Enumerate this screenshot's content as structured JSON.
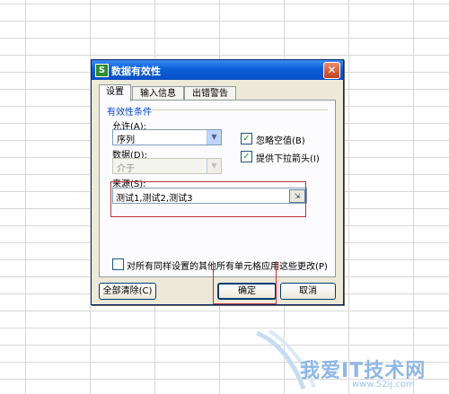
{
  "dialog": {
    "title": "数据有效性",
    "icon_letter": "S",
    "close_glyph": "✕",
    "tabs": [
      {
        "label": "设置",
        "active": true
      },
      {
        "label": "输入信息",
        "active": false
      },
      {
        "label": "出错警告",
        "active": false
      }
    ],
    "group_title": "有效性条件",
    "allow_label": "允许(A):",
    "allow_value": "序列",
    "data_label": "数据(D):",
    "data_value": "介于",
    "ignore_blank_label": "忽略空值(B)",
    "ignore_blank_checked": true,
    "dropdown_arrow_label": "提供下拉箭头(I)",
    "dropdown_arrow_checked": true,
    "source_label": "来源(S):",
    "source_value": "测试1,测试2,测试3",
    "apply_all_label": "对所有同样设置的其他所有单元格应用这些更改(P)",
    "apply_all_checked": false,
    "clear_all_label": "全部清除(C)",
    "ok_label": "确定",
    "cancel_label": "取消",
    "check_glyph": "✓",
    "arrow_glyph": "▼",
    "range_glyph": "⇲"
  },
  "watermark": {
    "text": "我爱IT技术网",
    "url": "www.52ij.com"
  },
  "colors": {
    "titlebar": "#0a5fd8",
    "dialog_bg": "#ece9d8",
    "highlight": "#c0303a",
    "group_title": "#0046d5"
  }
}
